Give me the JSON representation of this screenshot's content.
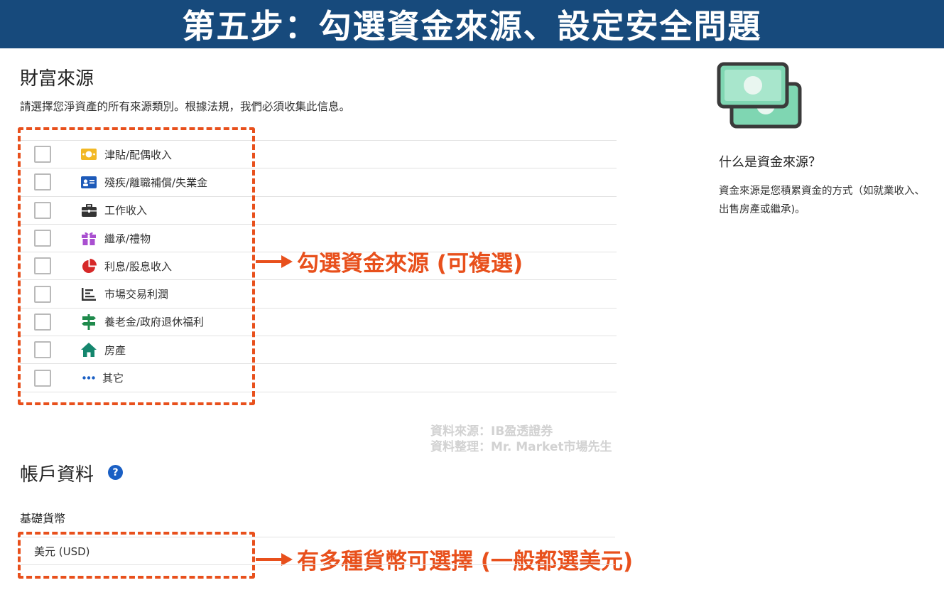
{
  "banner": {
    "title": "第五步：勾選資金來源、設定安全問題"
  },
  "wealth": {
    "title": "財富來源",
    "description": "請選擇您淨資產的所有來源類別。根據法規，我們必須收集此信息。",
    "items": [
      {
        "label": "津貼/配偶收入",
        "icon": "cash-icon"
      },
      {
        "label": "殘疾/離職補償/失業金",
        "icon": "id-card-icon"
      },
      {
        "label": "工作收入",
        "icon": "briefcase-icon"
      },
      {
        "label": "繼承/禮物",
        "icon": "gift-icon"
      },
      {
        "label": "利息/股息收入",
        "icon": "pie-chart-icon"
      },
      {
        "label": "市場交易利潤",
        "icon": "bar-chart-icon"
      },
      {
        "label": "養老金/政府退休福利",
        "icon": "signpost-icon"
      },
      {
        "label": "房產",
        "icon": "house-icon"
      },
      {
        "label": "其它",
        "icon": "more-dots-icon"
      }
    ]
  },
  "annotations": {
    "sources": "勾選資金來源 (可複選)",
    "currency": "有多種貨幣可選擇 (一般都選美元)"
  },
  "watermark": {
    "line1": "資料來源：IB盈透證券",
    "line2": "資料整理：Mr. Market市場先生"
  },
  "account": {
    "title": "帳戶資料",
    "help_icon": "?",
    "currency_label": "基礎貨幣",
    "currency_value": "美元 (USD)"
  },
  "side": {
    "title": "什么是資金來源？",
    "text": "資金來源是您積累資金的方式（如就業收入、出售房產或繼承)。"
  },
  "colors": {
    "banner": "#174a7c",
    "annotation": "#e8501c",
    "help": "#1a5fc4",
    "money": "#7fd6b2"
  }
}
